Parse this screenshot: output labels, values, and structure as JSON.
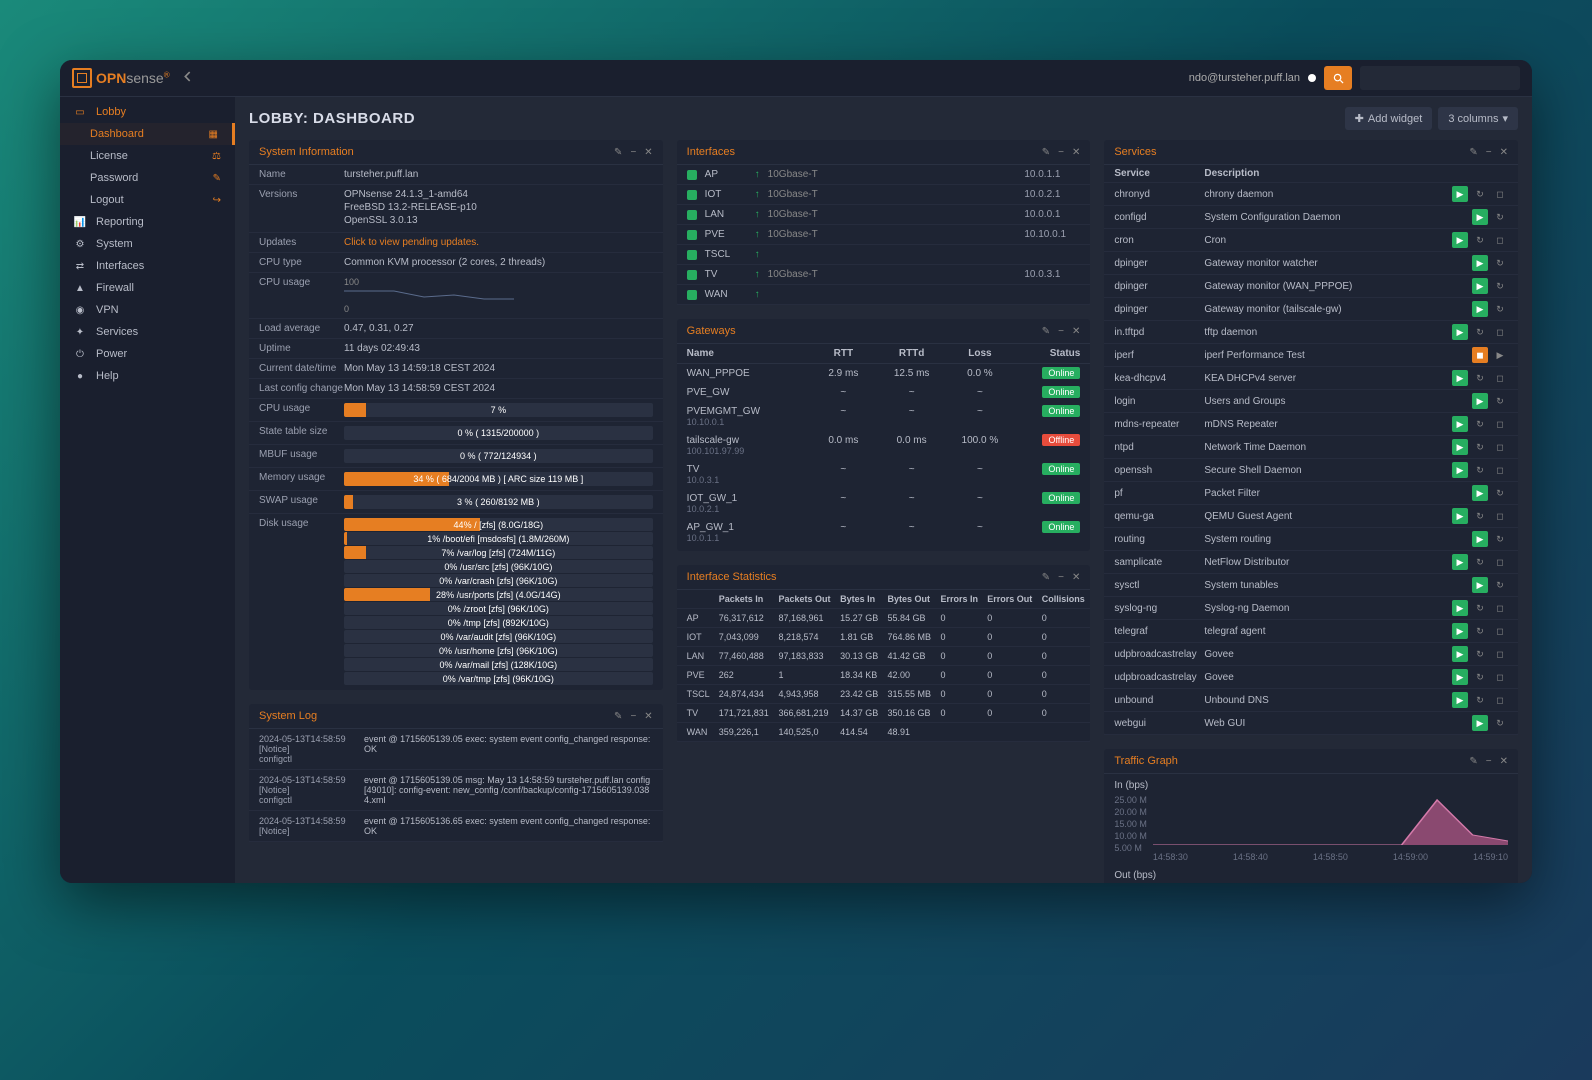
{
  "header": {
    "brand_prefix": "OPN",
    "brand_suffix": "sense",
    "user": "ndo@tursteher.puff.lan",
    "search_placeholder": ""
  },
  "page": {
    "title": "LOBBY: DASHBOARD",
    "add_widget": "Add widget",
    "columns": "3 columns"
  },
  "sidebar": {
    "items": [
      {
        "label": "Lobby",
        "icon": "laptop",
        "active": true,
        "sub": false
      },
      {
        "label": "Dashboard",
        "icon": "",
        "sub": true,
        "active": true,
        "right_icon": "grid"
      },
      {
        "label": "License",
        "icon": "",
        "sub": true,
        "right_icon": "balance"
      },
      {
        "label": "Password",
        "icon": "",
        "sub": true,
        "right_icon": "key"
      },
      {
        "label": "Logout",
        "icon": "",
        "sub": true,
        "right_icon": "exit"
      },
      {
        "label": "Reporting",
        "icon": "chart",
        "sub": false
      },
      {
        "label": "System",
        "icon": "gear",
        "sub": false
      },
      {
        "label": "Interfaces",
        "icon": "plug",
        "sub": false
      },
      {
        "label": "Firewall",
        "icon": "fire",
        "sub": false
      },
      {
        "label": "VPN",
        "icon": "globe",
        "sub": false
      },
      {
        "label": "Services",
        "icon": "wrench",
        "sub": false
      },
      {
        "label": "Power",
        "icon": "power",
        "sub": false
      },
      {
        "label": "Help",
        "icon": "help",
        "sub": false
      }
    ]
  },
  "sysinfo": {
    "title": "System Information",
    "name_label": "Name",
    "name": "tursteher.puff.lan",
    "versions_label": "Versions",
    "versions": [
      "OPNsense 24.1.3_1-amd64",
      "FreeBSD 13.2-RELEASE-p10",
      "OpenSSL 3.0.13"
    ],
    "updates_label": "Updates",
    "updates": "Click to view pending updates.",
    "cputype_label": "CPU type",
    "cputype": "Common KVM processor (2 cores, 2 threads)",
    "cpuusage_label": "CPU usage",
    "load_label": "Load average",
    "load": "0.47, 0.31, 0.27",
    "uptime_label": "Uptime",
    "uptime": "11 days 02:49:43",
    "date_label": "Current date/time",
    "date": "Mon May 13 14:59:18 CEST 2024",
    "lastcfg_label": "Last config change",
    "lastcfg": "Mon May 13 14:58:59 CEST 2024",
    "cpupct_label": "CPU usage",
    "cpupct": 7,
    "cpupct_text": "7 %",
    "state_label": "State table size",
    "state_text": "0 % ( 1315/200000 )",
    "mbuf_label": "MBUF usage",
    "mbuf_text": "0 % ( 772/124934 )",
    "mem_label": "Memory usage",
    "mem_pct": 34,
    "mem_text": "34 % ( 684/2004 MB ) [ ARC size 119 MB ]",
    "swap_label": "SWAP usage",
    "swap_pct": 3,
    "swap_text": "3 % ( 260/8192 MB )",
    "disk_label": "Disk usage",
    "disks": [
      {
        "pct": 44,
        "text": "44% / [zfs] (8.0G/18G)"
      },
      {
        "pct": 1,
        "text": "1% /boot/efi [msdosfs] (1.8M/260M)"
      },
      {
        "pct": 7,
        "text": "7% /var/log [zfs] (724M/11G)"
      },
      {
        "pct": 0,
        "text": "0% /usr/src [zfs] (96K/10G)"
      },
      {
        "pct": 0,
        "text": "0% /var/crash [zfs] (96K/10G)"
      },
      {
        "pct": 28,
        "text": "28% /usr/ports [zfs] (4.0G/14G)"
      },
      {
        "pct": 0,
        "text": "0% /zroot [zfs] (96K/10G)"
      },
      {
        "pct": 0,
        "text": "0% /tmp [zfs] (892K/10G)"
      },
      {
        "pct": 0,
        "text": "0% /var/audit [zfs] (96K/10G)"
      },
      {
        "pct": 0,
        "text": "0% /usr/home [zfs] (96K/10G)"
      },
      {
        "pct": 0,
        "text": "0% /var/mail [zfs] (128K/10G)"
      },
      {
        "pct": 0,
        "text": "0% /var/tmp [zfs] (96K/10G)"
      }
    ]
  },
  "syslog": {
    "title": "System Log",
    "entries": [
      {
        "time": "2024-05-13T14:58:59",
        "level": "[Notice]",
        "src": "configctl",
        "msg": "event @ 1715605139.05 exec: system event config_changed response: OK"
      },
      {
        "time": "2024-05-13T14:58:59",
        "level": "[Notice]",
        "src": "configctl",
        "msg": "event @ 1715605139.05 msg: May 13 14:58:59 tursteher.puff.lan config[49010]: config-event: new_config /conf/backup/config-1715605139.0384.xml"
      },
      {
        "time": "2024-05-13T14:58:59",
        "level": "[Notice]",
        "src": "",
        "msg": "event @ 1715605136.65 exec: system event config_changed response: OK"
      }
    ]
  },
  "interfaces": {
    "title": "Interfaces",
    "rows": [
      {
        "name": "AP",
        "speed": "10Gbase-T <full-duplex>",
        "ip": "10.0.1.1"
      },
      {
        "name": "IOT",
        "speed": "10Gbase-T <full-duplex>",
        "ip": "10.0.2.1"
      },
      {
        "name": "LAN",
        "speed": "10Gbase-T <full-duplex>",
        "ip": "10.0.0.1"
      },
      {
        "name": "PVE",
        "speed": "10Gbase-T <full-duplex>",
        "ip": "10.10.0.1"
      },
      {
        "name": "TSCL",
        "speed": "",
        "ip": ""
      },
      {
        "name": "TV",
        "speed": "10Gbase-T <full-duplex>",
        "ip": "10.0.3.1"
      },
      {
        "name": "WAN",
        "speed": "",
        "ip": ""
      }
    ]
  },
  "gateways": {
    "title": "Gateways",
    "cols": {
      "name": "Name",
      "rtt": "RTT",
      "rttd": "RTTd",
      "loss": "Loss",
      "status": "Status"
    },
    "rows": [
      {
        "name": "WAN_PPPOE",
        "sub": "",
        "rtt": "2.9 ms",
        "rttd": "12.5 ms",
        "loss": "0.0 %",
        "status": "Online"
      },
      {
        "name": "PVE_GW",
        "sub": "",
        "rtt": "~",
        "rttd": "~",
        "loss": "~",
        "status": "Online"
      },
      {
        "name": "PVEMGMT_GW",
        "sub": "10.10.0.1",
        "rtt": "~",
        "rttd": "~",
        "loss": "~",
        "status": "Online"
      },
      {
        "name": "tailscale-gw",
        "sub": "100.101.97.99",
        "rtt": "0.0 ms",
        "rttd": "0.0 ms",
        "loss": "100.0 %",
        "status": "Offline"
      },
      {
        "name": "TV",
        "sub": "10.0.3.1",
        "rtt": "~",
        "rttd": "~",
        "loss": "~",
        "status": "Online"
      },
      {
        "name": "IOT_GW_1",
        "sub": "10.0.2.1",
        "rtt": "~",
        "rttd": "~",
        "loss": "~",
        "status": "Online"
      },
      {
        "name": "AP_GW_1",
        "sub": "10.0.1.1",
        "rtt": "~",
        "rttd": "~",
        "loss": "~",
        "status": "Online"
      }
    ]
  },
  "ifstats": {
    "title": "Interface Statistics",
    "cols": [
      "",
      "Packets In",
      "Packets Out",
      "Bytes In",
      "Bytes Out",
      "Errors In",
      "Errors Out",
      "Collisions"
    ],
    "rows": [
      [
        "AP",
        "76,317,612",
        "87,168,961",
        "15.27 GB",
        "55.84 GB",
        "0",
        "0",
        "0"
      ],
      [
        "IOT",
        "7,043,099",
        "8,218,574",
        "1.81 GB",
        "764.86 MB",
        "0",
        "0",
        "0"
      ],
      [
        "LAN",
        "77,460,488",
        "97,183,833",
        "30.13 GB",
        "41.42 GB",
        "0",
        "0",
        "0"
      ],
      [
        "PVE",
        "262",
        "1",
        "18.34 KB",
        "42.00",
        "0",
        "0",
        "0"
      ],
      [
        "TSCL",
        "24,874,434",
        "4,943,958",
        "23.42 GB",
        "315.55 MB",
        "0",
        "0",
        "0"
      ],
      [
        "TV",
        "171,721,831",
        "366,681,219",
        "14.37 GB",
        "350.16 GB",
        "0",
        "0",
        "0"
      ],
      [
        "WAN",
        "359,226,1",
        "140,525,0",
        "414.54",
        "48.91",
        "",
        "",
        ""
      ]
    ]
  },
  "services": {
    "title": "Services",
    "col1": "Service",
    "col2": "Description",
    "rows": [
      {
        "name": "chronyd",
        "desc": "chrony daemon",
        "running": true
      },
      {
        "name": "configd",
        "desc": "System Configuration Daemon",
        "running": true,
        "norestart": false,
        "nostop": true
      },
      {
        "name": "cron",
        "desc": "Cron",
        "running": true
      },
      {
        "name": "dpinger",
        "desc": "Gateway monitor watcher",
        "running": true,
        "nostop": true
      },
      {
        "name": "dpinger",
        "desc": "Gateway monitor (WAN_PPPOE)",
        "running": true,
        "nostop": true
      },
      {
        "name": "dpinger",
        "desc": "Gateway monitor (tailscale-gw)",
        "running": true,
        "nostop": true
      },
      {
        "name": "in.tftpd",
        "desc": "tftp daemon",
        "running": true
      },
      {
        "name": "iperf",
        "desc": "iperf Performance Test",
        "running": false
      },
      {
        "name": "kea-dhcpv4",
        "desc": "KEA DHCPv4 server",
        "running": true
      },
      {
        "name": "login",
        "desc": "Users and Groups",
        "running": true,
        "nostop": true
      },
      {
        "name": "mdns-repeater",
        "desc": "mDNS Repeater",
        "running": true
      },
      {
        "name": "ntpd",
        "desc": "Network Time Daemon",
        "running": true
      },
      {
        "name": "openssh",
        "desc": "Secure Shell Daemon",
        "running": true
      },
      {
        "name": "pf",
        "desc": "Packet Filter",
        "running": true,
        "nostop": true
      },
      {
        "name": "qemu-ga",
        "desc": "QEMU Guest Agent",
        "running": true
      },
      {
        "name": "routing",
        "desc": "System routing",
        "running": true,
        "nostop": true
      },
      {
        "name": "samplicate",
        "desc": "NetFlow Distributor",
        "running": true
      },
      {
        "name": "sysctl",
        "desc": "System tunables",
        "running": true,
        "nostop": true
      },
      {
        "name": "syslog-ng",
        "desc": "Syslog-ng Daemon",
        "running": true
      },
      {
        "name": "telegraf",
        "desc": "telegraf agent",
        "running": true
      },
      {
        "name": "udpbroadcastrelay",
        "desc": "Govee",
        "running": true
      },
      {
        "name": "udpbroadcastrelay",
        "desc": "Govee",
        "running": true
      },
      {
        "name": "unbound",
        "desc": "Unbound DNS",
        "running": true
      },
      {
        "name": "webgui",
        "desc": "Web GUI",
        "running": true,
        "nostop": true
      }
    ]
  },
  "traffic": {
    "title": "Traffic Graph",
    "in_label": "In (bps)",
    "out_label": "Out (bps)",
    "yticks": [
      "25.00 M",
      "20.00 M",
      "15.00 M",
      "10.00 M",
      "5.00 M"
    ],
    "xticks": [
      "14:58:30",
      "14:58:40",
      "14:58:50",
      "14:59:00",
      "14:59:10"
    ]
  },
  "chart_data": {
    "type": "area",
    "title": "Traffic Graph — In (bps)",
    "xlabel": "time",
    "ylabel": "bps",
    "ylim": [
      0,
      25000000
    ],
    "x": [
      "14:58:30",
      "14:58:40",
      "14:58:50",
      "14:59:00",
      "14:59:10"
    ],
    "values": [
      0,
      0,
      0,
      23000000,
      2000000
    ]
  }
}
